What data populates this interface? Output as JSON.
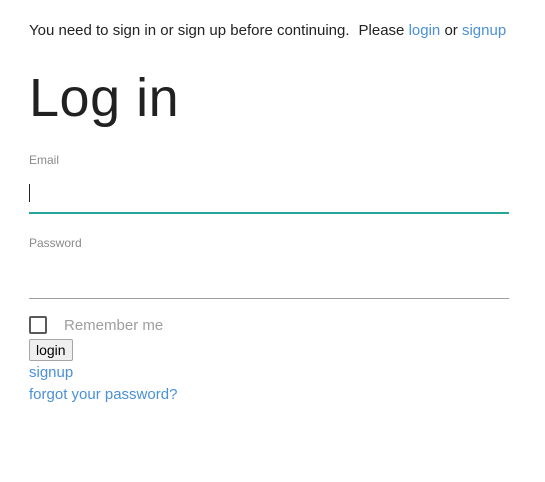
{
  "notice": {
    "message": "You need to sign in or sign up before continuing.",
    "please": "Please",
    "login_link": "login",
    "or": "or",
    "signup_link": "signup"
  },
  "page": {
    "title": "Log in"
  },
  "form": {
    "email_label": "Email",
    "email_value": "",
    "password_label": "Password",
    "password_value": "",
    "remember_label": "Remember me",
    "remember_checked": false,
    "submit_label": "login"
  },
  "links": {
    "signup": "signup",
    "forgot_password": "forgot your password?"
  },
  "colors": {
    "link": "#4a90d9",
    "focus_underline": "#26a69a",
    "label": "#8a8a8a"
  }
}
